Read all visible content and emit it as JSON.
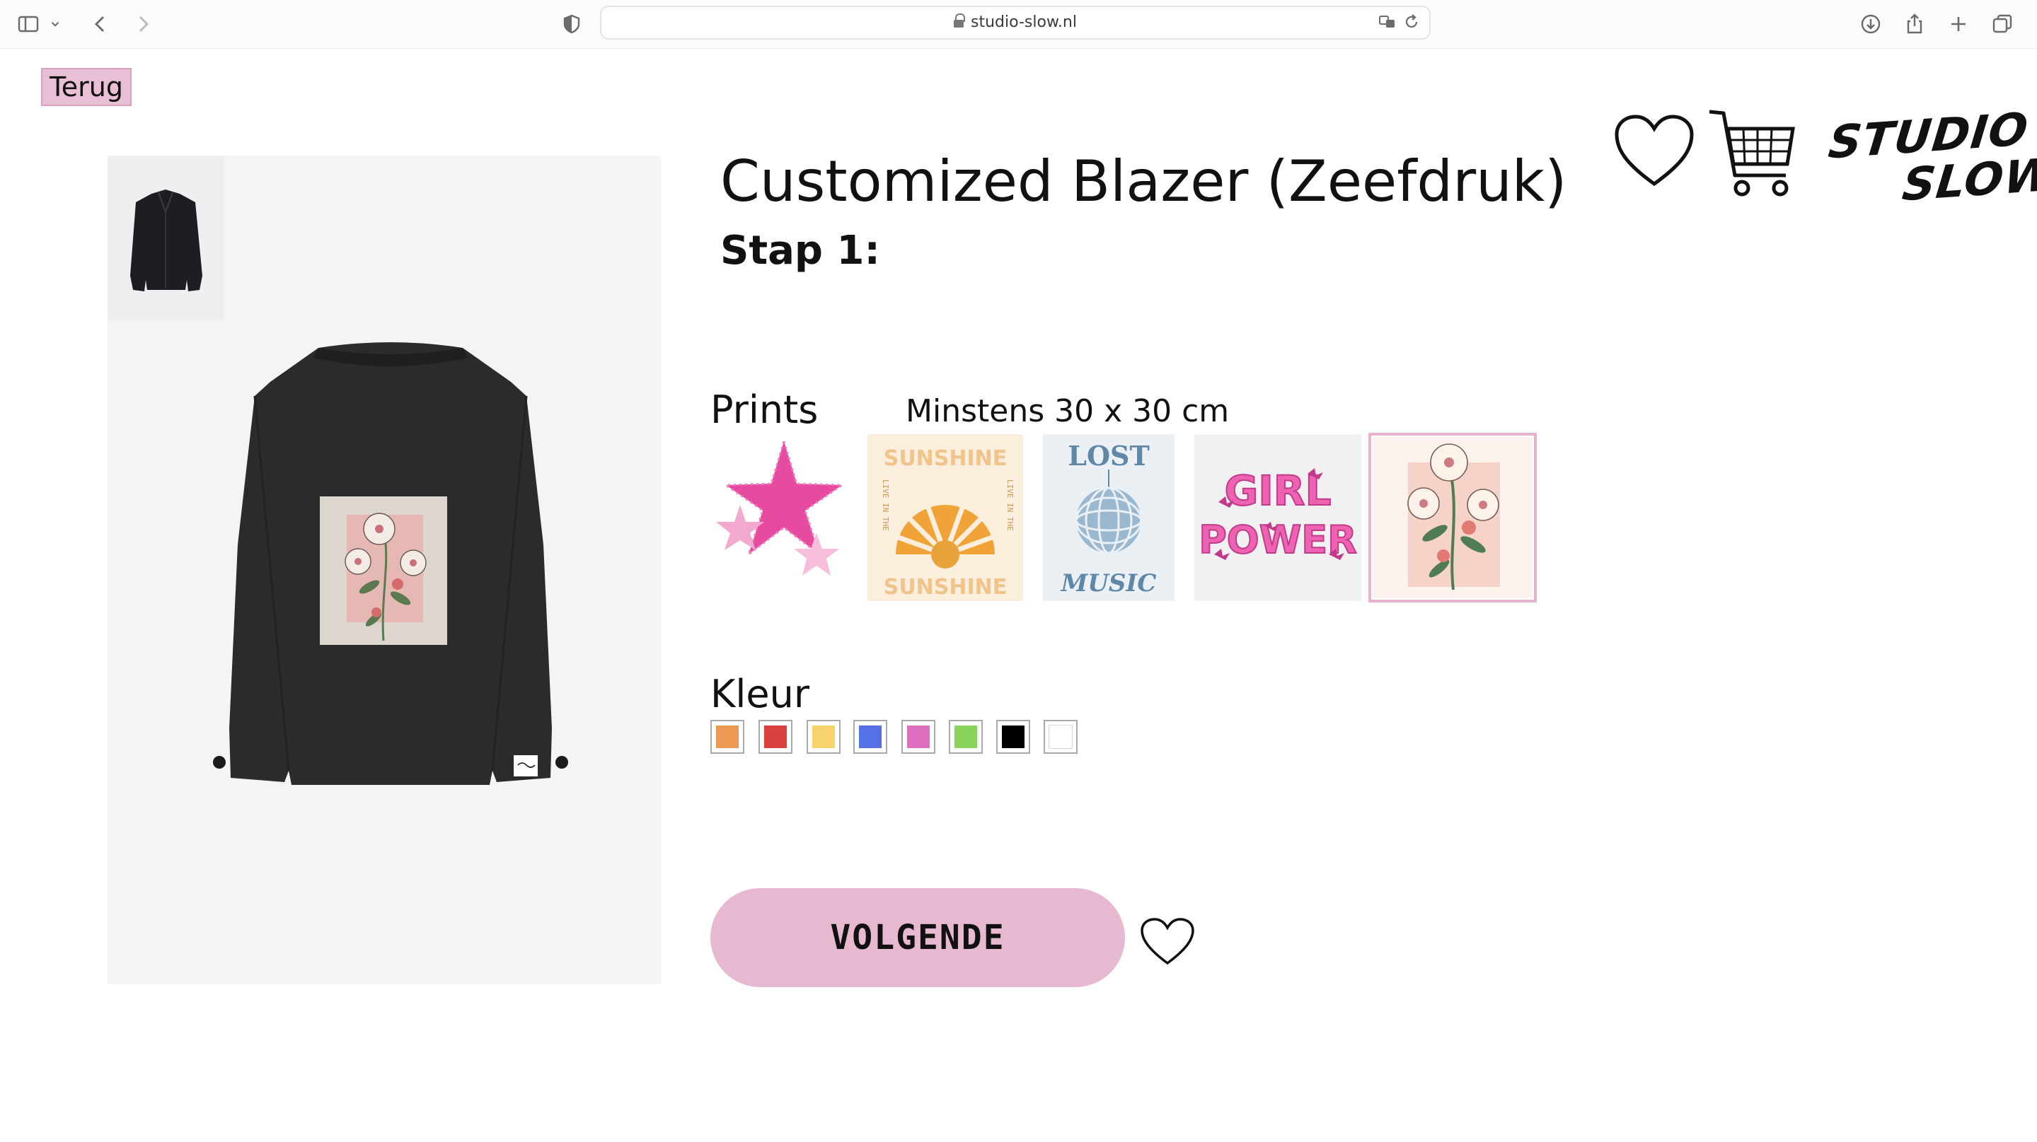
{
  "browser": {
    "url": "studio-slow.nl"
  },
  "page": {
    "back_label": "Terug",
    "product_title": "Customized Blazer (Zeefdruk)",
    "step_label": "Stap 1:",
    "prints": {
      "label": "Prints",
      "size_note": "Minstens 30 x 30 cm",
      "items": [
        {
          "name": "pink-stars-print",
          "selected": false
        },
        {
          "name": "sunshine-print",
          "text": "SUNSHINE",
          "side_text": "LIVE IN THE",
          "selected": false
        },
        {
          "name": "lost-in-music-print",
          "text_top": "LOST",
          "text_bottom": "MUSIC",
          "selected": false
        },
        {
          "name": "girl-power-print",
          "text_top": "GIRL",
          "text_bottom": "POWER",
          "selected": false
        },
        {
          "name": "flower-print",
          "selected": true
        }
      ]
    },
    "colors": {
      "label": "Kleur",
      "swatches": [
        "#ee9a55",
        "#d9413e",
        "#f6d36b",
        "#5670e6",
        "#dd6fbe",
        "#89d45c",
        "#000000",
        "#ffffff"
      ]
    },
    "next_label": "VOLGENDE",
    "logo_line1": "STUDIO",
    "logo_line2": "SLOW"
  },
  "theme": {
    "accent_pink": "#e6b9d0",
    "text": "#111111"
  }
}
